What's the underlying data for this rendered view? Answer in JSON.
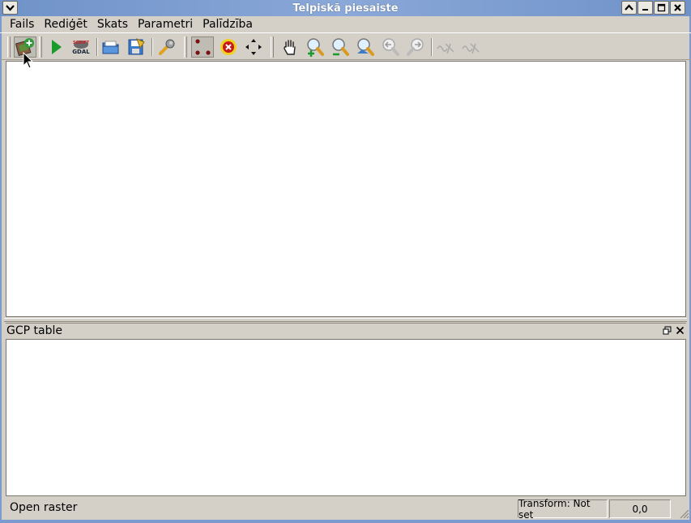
{
  "window": {
    "title": "Telpiskā piesaiste"
  },
  "menubar": {
    "items": [
      "Fails",
      "Rediģēt",
      "Skats",
      "Parametri",
      "Palīdzība"
    ]
  },
  "toolbar": {
    "tools": [
      {
        "icon": "open-raster-icon",
        "active": true
      },
      {
        "icon": "start-georeferencing-icon"
      },
      {
        "icon": "gdal-script-icon"
      },
      {
        "icon": "load-gcp-icon"
      },
      {
        "icon": "save-gcp-icon"
      },
      {
        "icon": "transformation-settings-icon"
      },
      {
        "icon": "add-point-icon",
        "active": true
      },
      {
        "icon": "delete-point-icon"
      },
      {
        "icon": "move-point-icon"
      },
      {
        "icon": "pan-icon"
      },
      {
        "icon": "zoom-in-icon"
      },
      {
        "icon": "zoom-out-icon"
      },
      {
        "icon": "zoom-to-layer-icon"
      },
      {
        "icon": "zoom-last-icon"
      },
      {
        "icon": "zoom-next-icon"
      },
      {
        "icon": "link-georef-to-qgis-icon"
      },
      {
        "icon": "link-qgis-to-georef-icon"
      }
    ]
  },
  "dock": {
    "title": "GCP table"
  },
  "status": {
    "message": "Open raster",
    "transform": "Transform: Not set",
    "coords": "0,0"
  },
  "colors": {
    "titlebar": "#7b9bd0",
    "background": "#d4d0c8"
  }
}
